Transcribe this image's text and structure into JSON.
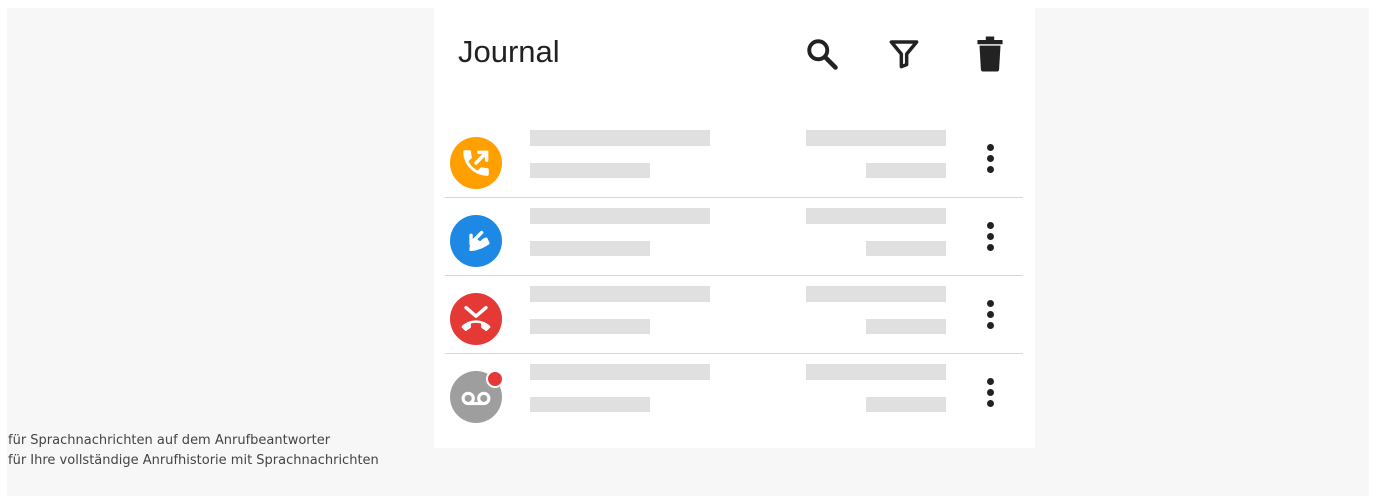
{
  "header": {
    "title": "Journal",
    "icons": [
      "search-icon",
      "filter-icon",
      "trash-icon"
    ]
  },
  "calls": [
    {
      "type": "outgoing",
      "icon": "outgoing-call-icon",
      "color": "#FFA000",
      "unread": false
    },
    {
      "type": "incoming",
      "icon": "incoming-call-icon",
      "color": "#1E88E5",
      "unread": false
    },
    {
      "type": "missed",
      "icon": "missed-call-icon",
      "color": "#E53935",
      "unread": false
    },
    {
      "type": "voicemail",
      "icon": "voicemail-icon",
      "color": "#9E9E9E",
      "unread": true
    }
  ],
  "captions": {
    "line1": "für Sprachnachrichten auf dem Anrufbeantworter",
    "line2": "für Ihre vollständige Anrufhistorie mit Sprachnachrichten"
  }
}
